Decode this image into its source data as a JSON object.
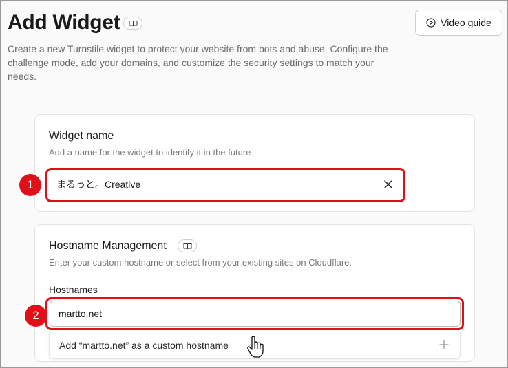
{
  "header": {
    "title": "Add Widget",
    "video_guide_label": "Video guide",
    "description": "Create a new Turnstile widget to protect your website from bots and abuse. Configure the challenge mode, add your domains, and customize the security settings to match your needs."
  },
  "widget_name_card": {
    "title": "Widget name",
    "subtitle": "Add a name for the widget to identify it in the future",
    "input_value": "まるっと。Creative"
  },
  "hostname_card": {
    "title": "Hostname Management",
    "subtitle": "Enter your custom hostname or select from your existing sites on Cloudflare.",
    "hostnames_label": "Hostnames",
    "input_value": "martto.net",
    "suggestion": "Add “martto.net” as a custom hostname"
  },
  "annotations": {
    "step1": "1",
    "step2": "2",
    "highlight_color": "#e0101a"
  },
  "icons": [
    "book-icon",
    "play-circle-icon",
    "close-icon",
    "plus-icon",
    "hand-cursor-icon"
  ]
}
